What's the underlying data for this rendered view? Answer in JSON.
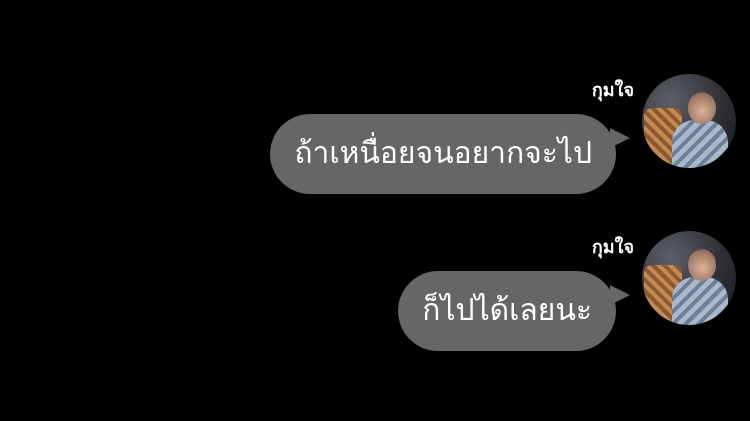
{
  "messages": [
    {
      "sender": "กุมใจ",
      "text": "ถ้าเหนื่อยจนอยากจะไป",
      "avatar": "profile-photo"
    },
    {
      "sender": "กุมใจ",
      "text": "ก็ไปได้เลยนะ",
      "avatar": "profile-photo"
    }
  ],
  "colors": {
    "background": "#000000",
    "bubble": "#666666",
    "text": "#ffffff"
  }
}
